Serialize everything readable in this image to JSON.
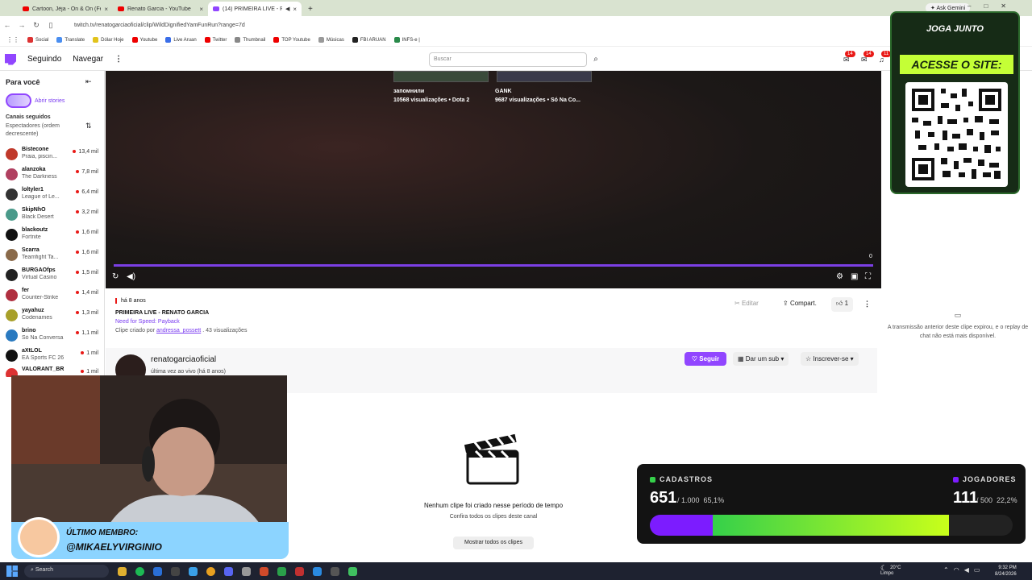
{
  "browser": {
    "tabs": [
      {
        "title": "Cartoon, Jéja - On & On (Feat...",
        "icon": "youtube-icon"
      },
      {
        "title": "Renato Garcia - YouTube",
        "icon": "youtube-icon"
      },
      {
        "title": "(14) PRIMEIRA LIVE - RENA...",
        "icon": "twitch-icon",
        "active": true
      }
    ],
    "url": "twitch.tv/renatogarciaoficial/clip/WildDignifiedYamFunRun?range=7d",
    "gemini_label": "Ask Gemini",
    "bookmarks": [
      "Social",
      "Translate",
      "Dólar Hoje",
      "Youtube",
      "Live Aruan",
      "Twitter",
      "Thumbnail",
      "TOP Youtube",
      "Músicas",
      "FBI ARUAN",
      "INFS-e |"
    ]
  },
  "twitch": {
    "nav": {
      "following": "Seguindo",
      "browse": "Navegar"
    },
    "search_placeholder": "Buscar",
    "badges": [
      "14",
      "14",
      "11"
    ],
    "sidebar": {
      "title": "Para você",
      "stories": "Abrir stories",
      "followed_header": "Canais seguidos",
      "followed_sort": "Espectadores (ordem decrescente)",
      "channels": [
        {
          "name": "Bistecone",
          "game": "Praia, piscin...",
          "viewers": "13,4 mil"
        },
        {
          "name": "alanzoka",
          "game": "The Darkness",
          "viewers": "7,8 mil"
        },
        {
          "name": "loltyler1",
          "game": "League of Le...",
          "viewers": "6,4 mil"
        },
        {
          "name": "SkipNhO",
          "game": "Black Desert",
          "viewers": "3,2 mil"
        },
        {
          "name": "blackoutz",
          "game": "Fortnite",
          "viewers": "1,6 mil"
        },
        {
          "name": "Scarra",
          "game": "Teamfight Ta...",
          "viewers": "1,6 mil"
        },
        {
          "name": "BURGAOfps",
          "game": "Virtual Casino",
          "viewers": "1,5 mil"
        },
        {
          "name": "fer",
          "game": "Counter-Strike",
          "viewers": "1,4 mil"
        },
        {
          "name": "yayahuz",
          "game": "Codenames",
          "viewers": "1,3 mil"
        },
        {
          "name": "brino",
          "game": "Só Na Conversa",
          "viewers": "1,1 mil"
        },
        {
          "name": "aXtLOL",
          "game": "EA Sports FC 26",
          "viewers": "1 mil"
        },
        {
          "name": "VALORANT_BR",
          "game": "",
          "viewers": "1 mil"
        }
      ]
    },
    "player": {
      "recommendations": [
        {
          "title": "запомнили",
          "meta": "10568 visualizações • Dota 2"
        },
        {
          "title": "GANK",
          "meta": "9687 visualizações • Só Na Co..."
        }
      ],
      "counter": "0",
      "progress": 1.0
    },
    "clip": {
      "ago": "há 8 anos",
      "title": "PRIMEIRA LIVE - RENATO GARCIA",
      "game": "Need for Speed: Payback",
      "created_prefix": "Clipe criado por",
      "creator": "andressa_possett",
      "views": ". 43 visualizações",
      "edit": "Editar",
      "share": "Compart.",
      "likes": "1"
    },
    "channel": {
      "name": "renatogarciaoficial",
      "last_live": "última vez ao vivo (há 8 anos)",
      "follow": "Seguir",
      "gift_sub": "Dar um sub",
      "subscribe": "Inscrever-se"
    },
    "empty_state": {
      "title": "Nenhum clipe foi criado nesse período de tempo",
      "subtitle": "Confira todos os clipes deste canal",
      "button": "Mostrar todos os clipes"
    },
    "chat_message": "A transmissão anterior deste clipe expirou, e o replay de chat não está mais disponível."
  },
  "overlays": {
    "qr": {
      "brand": "JOGA JUNTO",
      "cta": "ACESSE O SITE:"
    },
    "member": {
      "label": "ÚLTIMO MEMBRO:",
      "name": "@MIKAELYVIRGINIO"
    },
    "stats": {
      "left": {
        "label": "CADASTROS",
        "value": "651",
        "goal": "/ 1.000",
        "pct": "65,1%",
        "fraction": 0.651,
        "color": "#35d04a"
      },
      "right": {
        "label": "JOGADORES",
        "value": "111",
        "goal": "/ 500",
        "pct": "22,2%",
        "fraction": 0.222,
        "color": "#7c1cff"
      }
    }
  },
  "taskbar": {
    "search": "Search",
    "weather_temp": "20°C",
    "weather_desc": "Limpo",
    "time": "9:32 PM",
    "date": "8/24/2026"
  }
}
